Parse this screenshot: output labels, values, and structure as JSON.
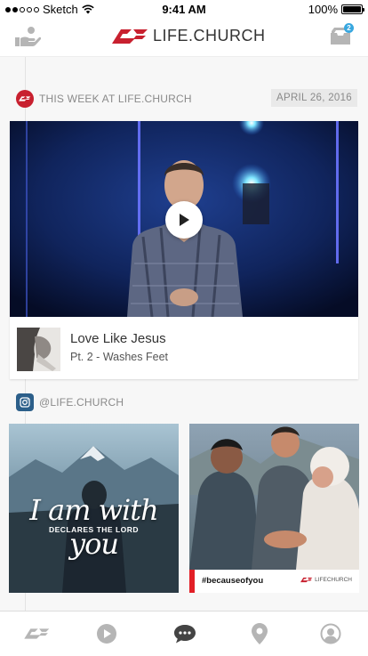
{
  "status_bar": {
    "carrier": "Sketch",
    "time": "9:41 AM",
    "battery": "100%",
    "battery_level": 1.0
  },
  "nav": {
    "logo_text": "LIFE.CHURCH",
    "inbox_count": "2",
    "left_icon": "giving-hand-icon",
    "right_icon": "inbox-icon"
  },
  "feed": {
    "this_week": {
      "label": "THIS WEEK AT LIFE.CHURCH",
      "date": "APRIL 26, 2016",
      "video": {
        "title": "Love Like Jesus",
        "subtitle": "Pt. 2 - Washes Feet"
      }
    },
    "instagram": {
      "label": "@LIFE.CHURCH",
      "photos": [
        {
          "caption": "I am with you",
          "subcaption": "DECLARES THE LORD"
        },
        {
          "hashtag": "#becauseofyou",
          "brand": "LIFECHURCH"
        }
      ]
    }
  },
  "tabs": [
    {
      "icon": "lifechurch-logo-icon",
      "active": false
    },
    {
      "icon": "play-icon",
      "active": false
    },
    {
      "icon": "chat-icon",
      "active": true
    },
    {
      "icon": "location-pin-icon",
      "active": false
    },
    {
      "icon": "profile-icon",
      "active": false
    }
  ],
  "colors": {
    "brand_red": "#c8202f",
    "badge_blue": "#38a7df",
    "instagram_blue": "#2c5f8a",
    "active_tab": "#444444",
    "inactive_tab": "#b5b5b5"
  }
}
